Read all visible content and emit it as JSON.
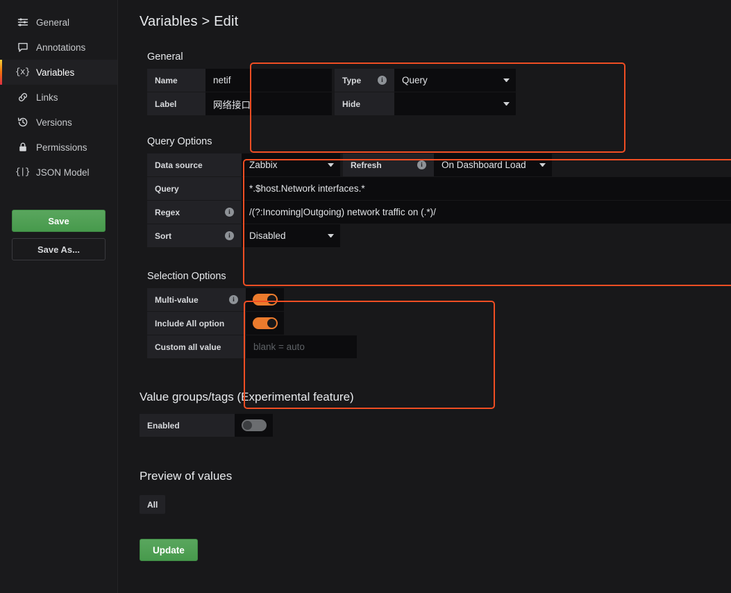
{
  "sidebar": {
    "items": [
      {
        "label": "General",
        "icon": "sliders-icon",
        "active": false
      },
      {
        "label": "Annotations",
        "icon": "comment-icon",
        "active": false
      },
      {
        "label": "Variables",
        "icon": "curly-x-icon",
        "active": true
      },
      {
        "label": "Links",
        "icon": "link-icon",
        "active": false
      },
      {
        "label": "Versions",
        "icon": "history-icon",
        "active": false
      },
      {
        "label": "Permissions",
        "icon": "lock-icon",
        "active": false
      },
      {
        "label": "JSON Model",
        "icon": "curly-braces-icon",
        "active": false
      }
    ],
    "save_label": "Save",
    "save_as_label": "Save As..."
  },
  "page": {
    "title": "Variables > Edit"
  },
  "general": {
    "title": "General",
    "name_label": "Name",
    "name_value": "netif",
    "type_label": "Type",
    "type_value": "Query",
    "label_label": "Label",
    "label_value": "网络接口",
    "hide_label": "Hide",
    "hide_value": ""
  },
  "query_options": {
    "title": "Query Options",
    "datasource_label": "Data source",
    "datasource_value": "Zabbix",
    "refresh_label": "Refresh",
    "refresh_value": "On Dashboard Load",
    "query_label": "Query",
    "query_value": "*.$host.Network interfaces.*",
    "regex_label": "Regex",
    "regex_value": "/(?:Incoming|Outgoing) network traffic on (.*)/",
    "sort_label": "Sort",
    "sort_value": "Disabled"
  },
  "selection_options": {
    "title": "Selection Options",
    "multi_value_label": "Multi-value",
    "multi_value_on": true,
    "include_all_label": "Include All option",
    "include_all_on": true,
    "custom_all_label": "Custom all value",
    "custom_all_value": "",
    "custom_all_placeholder": "blank = auto"
  },
  "value_groups": {
    "title": "Value groups/tags (Experimental feature)",
    "enabled_label": "Enabled",
    "enabled_on": false
  },
  "preview": {
    "title": "Preview of values",
    "values": [
      "All"
    ]
  },
  "footer": {
    "update_label": "Update"
  },
  "colors": {
    "highlight": "#f04e23",
    "accent_green": "#479a4c",
    "toggle_on": "#eb7b2d",
    "background": "#18181a",
    "panel": "#222226",
    "input": "#0c0c0e"
  }
}
